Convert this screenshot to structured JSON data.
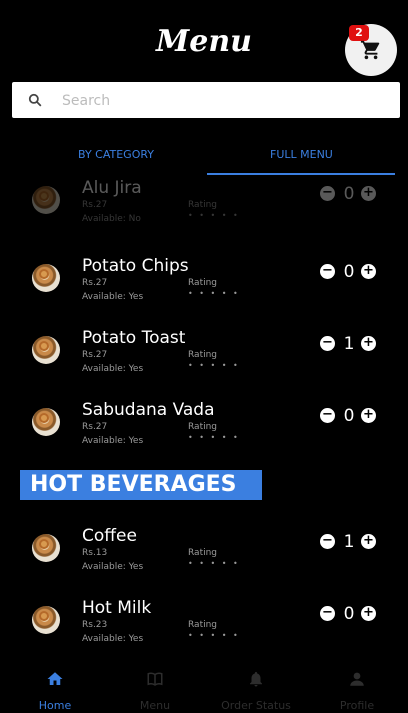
{
  "header": {
    "title": "Menu",
    "cart_count": "2",
    "cart_icon": "cart-icon"
  },
  "search": {
    "placeholder": "Search",
    "value": ""
  },
  "tabs": [
    {
      "label": "BY CATEGORY"
    },
    {
      "label": "FULL MENU"
    }
  ],
  "items": [
    {
      "name": "Alu Jira",
      "price": "Rs.27",
      "available": "Available: No",
      "rating_label": "Rating",
      "stars": "• • • • •",
      "qty": "0"
    },
    {
      "name": "Potato Chips",
      "price": "Rs.27",
      "available": "Available: Yes",
      "rating_label": "Rating",
      "stars": "• • • • •",
      "qty": "0"
    },
    {
      "name": "Potato Toast",
      "price": "Rs.27",
      "available": "Available: Yes",
      "rating_label": "Rating",
      "stars": "• • • • •",
      "qty": "1"
    },
    {
      "name": "Sabudana Vada",
      "price": "Rs.27",
      "available": "Available: Yes",
      "rating_label": "Rating",
      "stars": "• • • • •",
      "qty": "0"
    },
    {
      "name": "Coffee",
      "price": "Rs.13",
      "available": "Available: Yes",
      "rating_label": "Rating",
      "stars": "• • • • •",
      "qty": "1"
    },
    {
      "name": "Hot Milk",
      "price": "Rs.23",
      "available": "Available: Yes",
      "rating_label": "Rating",
      "stars": "• • • • •",
      "qty": "0"
    }
  ],
  "section": {
    "title": "HOT BEVERAGES"
  },
  "nav": [
    {
      "label": "Home",
      "icon": "home-icon",
      "active": true
    },
    {
      "label": "Menu",
      "icon": "book-icon",
      "active": false
    },
    {
      "label": "Order Status",
      "icon": "bell-icon",
      "active": false
    },
    {
      "label": "Profile",
      "icon": "person-icon",
      "active": false
    }
  ],
  "colors": {
    "accent": "#3b7fe0",
    "badge": "#e01010",
    "background": "#000000"
  }
}
